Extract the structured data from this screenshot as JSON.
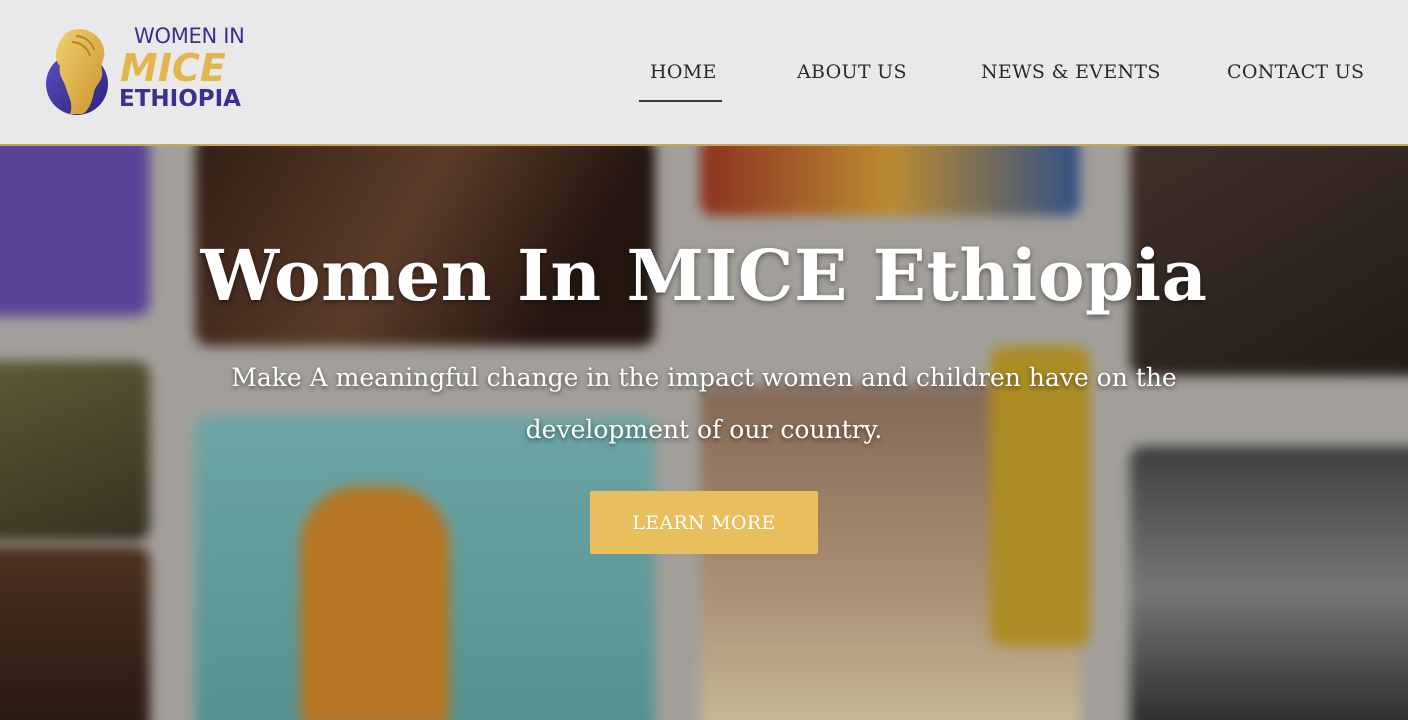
{
  "header": {
    "logo": {
      "line1": "WOMEN IN",
      "line2": "MICE",
      "line3": "ETHIOPIA",
      "icon": "woman-silhouette-globe-icon",
      "colors": {
        "purple": "#3b2f8f",
        "gold": "#e2b64f"
      }
    },
    "nav": {
      "items": [
        {
          "label": "HOME",
          "active": true
        },
        {
          "label": "ABOUT US",
          "active": false
        },
        {
          "label": "NEWS & EVENTS",
          "active": false
        },
        {
          "label": "CONTACT US",
          "active": false
        }
      ]
    },
    "accent_border_color": "#c9a55a"
  },
  "hero": {
    "title": "Women In MICE Ethiopia",
    "subtitle": "Make A meaningful change in the impact women and children have on the development of our country.",
    "cta_label": "LEARN MORE",
    "cta_color": "#e9bf5e",
    "background": "blurred photo collage of women and children"
  }
}
